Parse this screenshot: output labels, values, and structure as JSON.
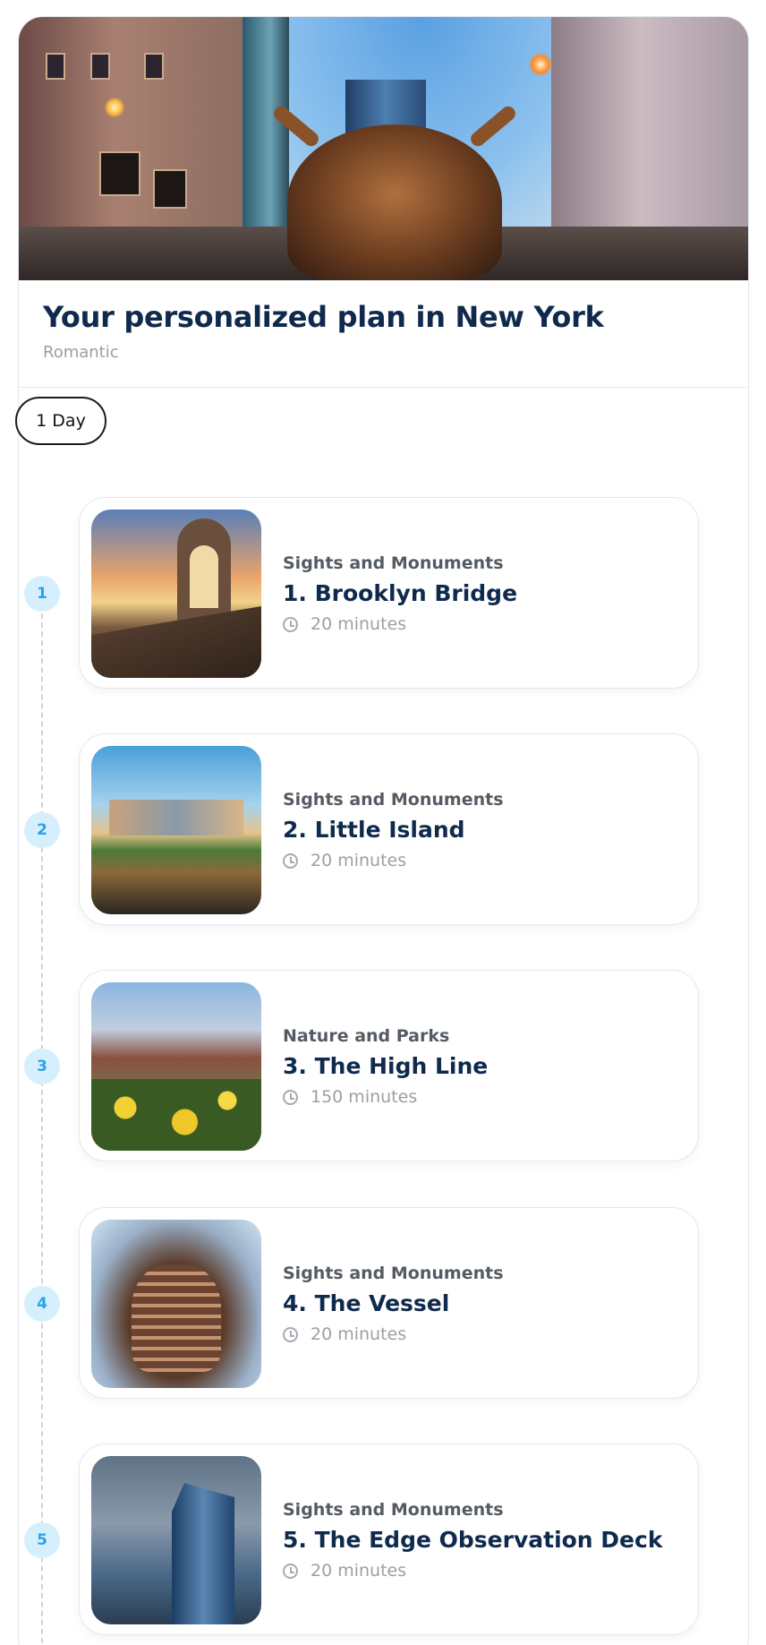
{
  "header": {
    "title": "Your personalized plan in New York",
    "subtitle": "Romantic"
  },
  "day_selector": {
    "label": "1 Day"
  },
  "stops": [
    {
      "number": "1",
      "category": "Sights and Monuments",
      "name": "1. Brooklyn Bridge",
      "duration": "20 minutes"
    },
    {
      "number": "2",
      "category": "Sights and Monuments",
      "name": "2. Little Island",
      "duration": "20 minutes"
    },
    {
      "number": "3",
      "category": "Nature and Parks",
      "name": "3. The High Line",
      "duration": "150 minutes"
    },
    {
      "number": "4",
      "category": "Sights and Monuments",
      "name": "4. The Vessel",
      "duration": "20 minutes"
    },
    {
      "number": "5",
      "category": "Sights and Monuments",
      "name": "5. The Edge Observation Deck",
      "duration": "20 minutes"
    }
  ],
  "icons": {
    "duration": "clock-icon"
  },
  "colors": {
    "title": "#0f2a4d",
    "step_badge_bg": "#d6effd",
    "step_badge_text": "#29a3ec"
  }
}
